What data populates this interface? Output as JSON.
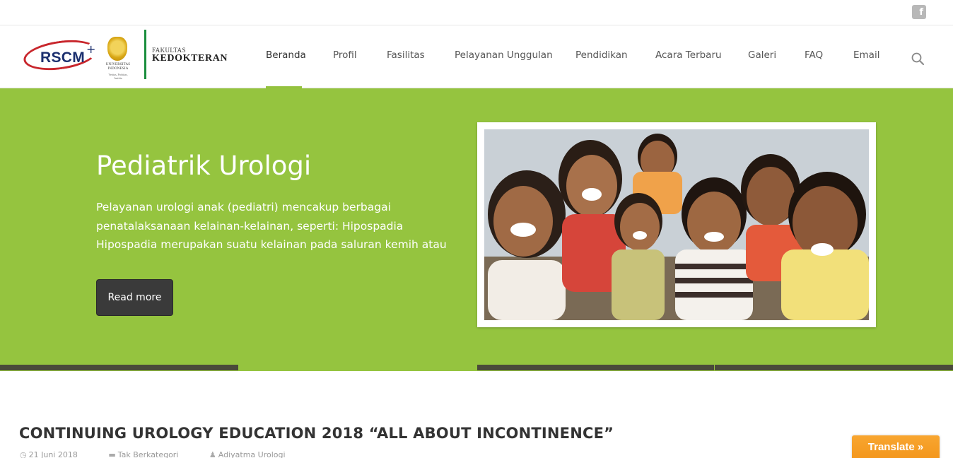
{
  "topbar": {
    "social_icon": "facebook-icon"
  },
  "logo": {
    "rscm": "RSCM",
    "plus": "+",
    "ui_name": "UNIVERSITAS INDONESIA",
    "ui_motto": "Veritas, Probitas, Iustitia",
    "faculty_small": "FAKULTAS",
    "faculty_big": "KEDOKTERAN",
    "colors": {
      "rscm_red": "#c8262c",
      "rscm_blue": "#1b2f6e",
      "faculty_green": "#1a8e3d"
    }
  },
  "nav": {
    "items": [
      {
        "label": "Beranda",
        "active": true
      },
      {
        "label": "Profil"
      },
      {
        "label": "Fasilitas"
      },
      {
        "label": "Pelayanan Unggulan"
      },
      {
        "label": "Pendidikan"
      },
      {
        "label": "Acara Terbaru"
      },
      {
        "label": "Galeri"
      },
      {
        "label": "FAQ"
      },
      {
        "label": "Email"
      }
    ],
    "search_icon": "search-icon",
    "accent": "#94c13f"
  },
  "hero": {
    "title": "Pediatrik Urologi",
    "text_lines": [
      "Pelayanan urologi anak (pediatri) mencakup berbagai",
      "penatalaksanaan kelainan-kelainan, seperti: Hipospadia",
      "Hipospadia merupakan suatu kelainan pada saluran kemih atau"
    ],
    "button": "Read more",
    "background": "#95c43f",
    "image_subject": "group of smiling children"
  },
  "slider": {
    "slide_count": 4,
    "active_index": 1
  },
  "post": {
    "title": "CONTINUING UROLOGY EDUCATION 2018 “ALL ABOUT INCONTINENCE”",
    "date": "21 Juni 2018",
    "category": "Tak Berkategori",
    "author": "Adiyatma Urologi"
  },
  "translate": {
    "label": "Translate »"
  }
}
